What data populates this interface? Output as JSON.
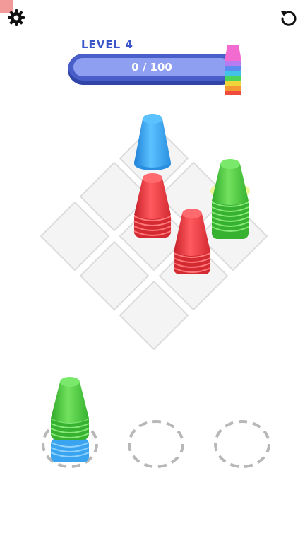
{
  "hud": {
    "level_label": "LEVEL 4",
    "progress_text": "0 / 100",
    "progress_fraction": 0.0
  },
  "icons": {
    "settings": "gear-icon",
    "restart": "restart-icon",
    "reward": "rainbow-cup-stack-icon"
  },
  "colors": {
    "accent": "#4a5ec9",
    "cup_blue": "#3aa4f0",
    "cup_red": "#e8343c",
    "cup_green": "#46c93a",
    "tile": "#f2f2f2",
    "slot_dash": "#b8b8b8"
  },
  "board": {
    "tiles": 9,
    "stacks": [
      {
        "tile": "top",
        "cups": [
          "blue"
        ]
      },
      {
        "tile": "middle",
        "cups": [
          "red",
          "red",
          "red",
          "red",
          "red"
        ]
      },
      {
        "tile": "right",
        "cups": [
          "green",
          "green",
          "green",
          "green",
          "green",
          "green",
          "green",
          "green"
        ]
      },
      {
        "tile": "middle-right",
        "cups": [
          "red",
          "red",
          "red",
          "red",
          "red"
        ]
      }
    ]
  },
  "tray": {
    "slots": [
      {
        "name": "slot-1",
        "cups": [
          "blue",
          "blue",
          "blue",
          "green",
          "green",
          "green",
          "green",
          "green"
        ]
      },
      {
        "name": "slot-2",
        "cups": []
      },
      {
        "name": "slot-3",
        "cups": []
      }
    ]
  }
}
